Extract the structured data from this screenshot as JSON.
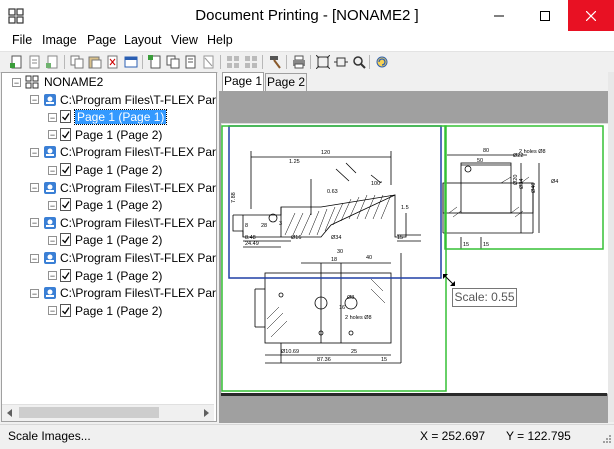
{
  "window": {
    "title": "Document Printing - [NONAME2 ]"
  },
  "menu": {
    "items": [
      "File",
      "Image",
      "Page",
      "Layout",
      "View",
      "Help"
    ]
  },
  "tree": {
    "root": "NONAME2",
    "documents": [
      {
        "path": "C:\\Program Files\\T-FLEX Parar",
        "pages": [
          "Page 1 (Page 1)",
          "Page 1 (Page 2)"
        ]
      },
      {
        "path": "C:\\Program Files\\T-FLEX Parar",
        "pages": [
          "Page 1 (Page 2)"
        ]
      },
      {
        "path": "C:\\Program Files\\T-FLEX Parar",
        "pages": [
          "Page 1 (Page 2)"
        ]
      },
      {
        "path": "C:\\Program Files\\T-FLEX Parar",
        "pages": [
          "Page 1 (Page 2)"
        ]
      },
      {
        "path": "C:\\Program Files\\T-FLEX Parar",
        "pages": [
          "Page 1 (Page 2)"
        ]
      },
      {
        "path": "C:\\Program Files\\T-FLEX Parar",
        "pages": [
          "Page 1 (Page 2)"
        ]
      }
    ],
    "selected": "Page 1 (Page 1)"
  },
  "tabs": [
    "Page 1",
    "Page 2"
  ],
  "tooltip": {
    "text": "Scale: 0.55"
  },
  "drawing": {
    "dims_left": [
      "120",
      "1.25",
      "0.63",
      "100°",
      "7.88",
      "8",
      "28",
      "3",
      "8.48",
      "24.49",
      "Ø16",
      "Ø34",
      "15",
      "1.5"
    ],
    "dims_right": [
      "80",
      "50",
      "Ø22",
      "2 holes Ø8",
      "Ø20",
      "Ø34",
      "Ø40",
      "Ø4",
      "15",
      "15"
    ],
    "dims_bottom": [
      "18",
      "30",
      "40",
      "Ø8",
      "2 holes Ø8",
      "16",
      "Ø10.69",
      "87.36",
      "25",
      "15"
    ]
  },
  "status": {
    "left": "Scale Images...",
    "x": "X = 252.697",
    "y": "Y = 122.795"
  },
  "colors": {
    "selection": "#3399ff",
    "blue_frame": "#1f3fa5",
    "green_frame": "#35c135"
  }
}
